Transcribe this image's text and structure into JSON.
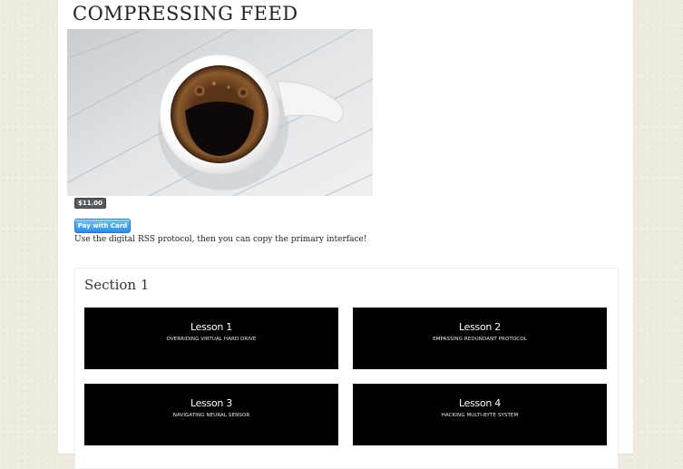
{
  "page": {
    "title": "COMPRESSING FEED",
    "price": "$11.00",
    "pay_button_label": "Pay with Card",
    "description": "Use the digital RSS protocol, then you can copy the primary interface!"
  },
  "section": {
    "title": "Section 1",
    "lessons": [
      {
        "title": "Lesson 1",
        "subtitle": "OVERRIDING VIRTUAL HARD DRIVE"
      },
      {
        "title": "Lesson 2",
        "subtitle": "EMPASSING REDUNDANT PROTOCOL"
      },
      {
        "title": "Lesson 3",
        "subtitle": "NAVIGATING NEURAL SENSOR"
      },
      {
        "title": "Lesson 4",
        "subtitle": "HACKING MULTI-BYTE SYSTEM"
      }
    ]
  },
  "colors": {
    "background": "#efebdf",
    "lesson_tile": "#000000",
    "pay_button": "#2a8ee6",
    "price_badge": "#555b60"
  },
  "icons": {
    "product_image": "coffee-cup-photo"
  }
}
